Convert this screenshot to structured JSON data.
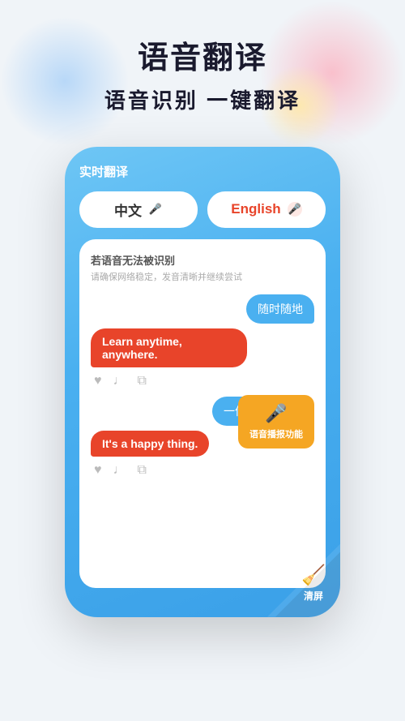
{
  "background": {
    "color": "#f0f4f8"
  },
  "header": {
    "main_title": "语音翻译",
    "sub_title": "语音识别 一键翻译"
  },
  "phone": {
    "title": "实时翻译",
    "lang_chinese": {
      "label": "中文",
      "mic_symbol": "🎤"
    },
    "lang_english": {
      "label": "English",
      "mic_symbol": "🎤"
    },
    "unrecognized": {
      "title": "若语音无法被识别",
      "subtitle": "请确保网络稳定，发音清晰并继续尝试"
    },
    "messages": [
      {
        "side": "right",
        "text": "随时随地",
        "lang": "zh"
      },
      {
        "side": "left",
        "text": "Learn anytime, anywhere.",
        "lang": "en"
      },
      {
        "side": "right",
        "text": "一件快乐的事。",
        "lang": "zh"
      },
      {
        "side": "left",
        "text": "It's a happy thing.",
        "lang": "en"
      }
    ],
    "tooltip": {
      "icon": "🎤",
      "label": "语音播报功能"
    },
    "clear_btn": {
      "label": "清屏"
    },
    "action_icons": {
      "heart": "♥",
      "speaker": "🔊",
      "copy": "⧉"
    }
  }
}
